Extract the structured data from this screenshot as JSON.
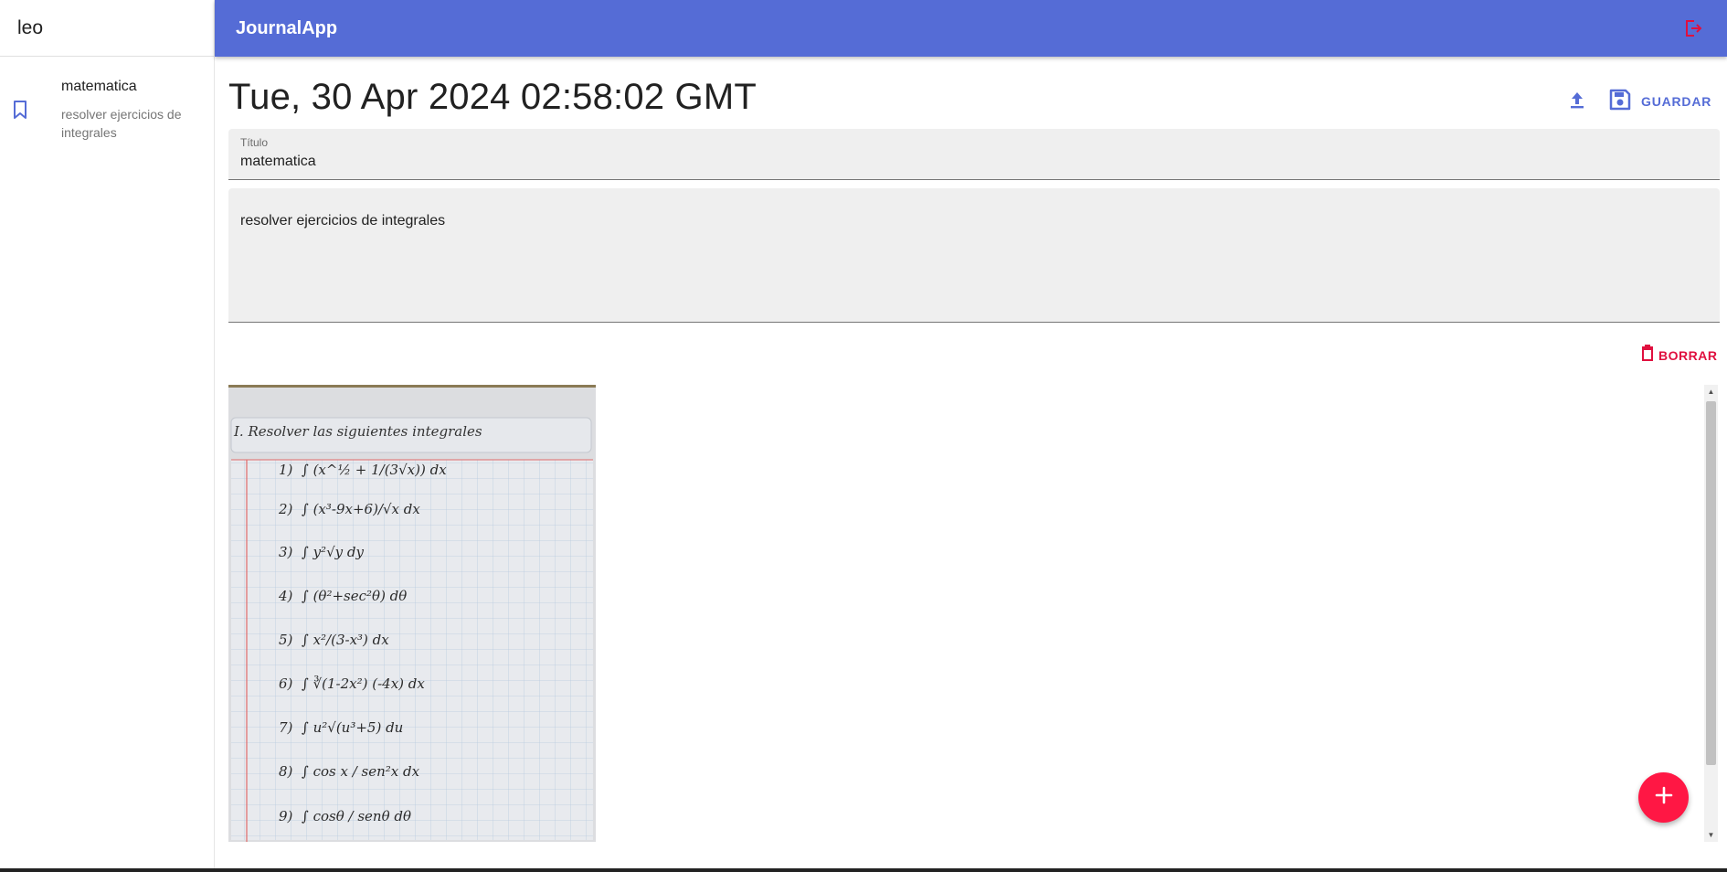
{
  "sidebar": {
    "user_name": "leo",
    "notes": [
      {
        "title": "matematica",
        "body": "resolver ejercicios de integrales",
        "icon": "bookmark-icon"
      }
    ]
  },
  "appbar": {
    "title": "JournalApp",
    "logout_icon": "logout-icon"
  },
  "note_view": {
    "date": "Tue, 30 Apr 2024 02:58:02 GMT",
    "upload_icon": "upload-icon",
    "save_label": "GUARDAR",
    "title_label": "Título",
    "title_value": "matematica",
    "body_value": "resolver ejercicios de integrales",
    "delete_label": "BORRAR"
  },
  "worksheet": {
    "heading": "I. Resolver las siguientes integrales",
    "items": [
      "1)",
      "2)",
      "3)",
      "4)",
      "5)",
      "6)",
      "7)",
      "8)",
      "9)"
    ],
    "expressions": [
      "∫ (x^½ + 1/(3√x)) dx",
      "∫ (x³-9x+6)/√x dx",
      "∫ y²√y dy",
      "∫ (θ²+sec²θ) dθ",
      "∫ x²/(3-x³) dx",
      "∫ ∛(1-2x²) (-4x) dx",
      "∫ u²√(u³+5) du",
      "∫ cos x / sen²x dx",
      "∫ cosθ / senθ dθ"
    ]
  },
  "colors": {
    "primary": "#556cd6",
    "error": "#e0103f",
    "fab": "#ff1744",
    "field_bg": "#efefef"
  },
  "fab_icon": "plus-icon"
}
